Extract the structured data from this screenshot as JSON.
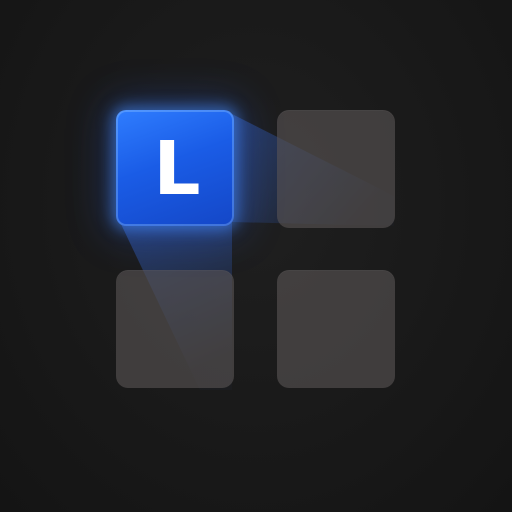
{
  "key": {
    "letter": "L",
    "color": "#1a5ce6"
  },
  "grid": {
    "tile_color": "#585454",
    "background_color": "#181818"
  }
}
